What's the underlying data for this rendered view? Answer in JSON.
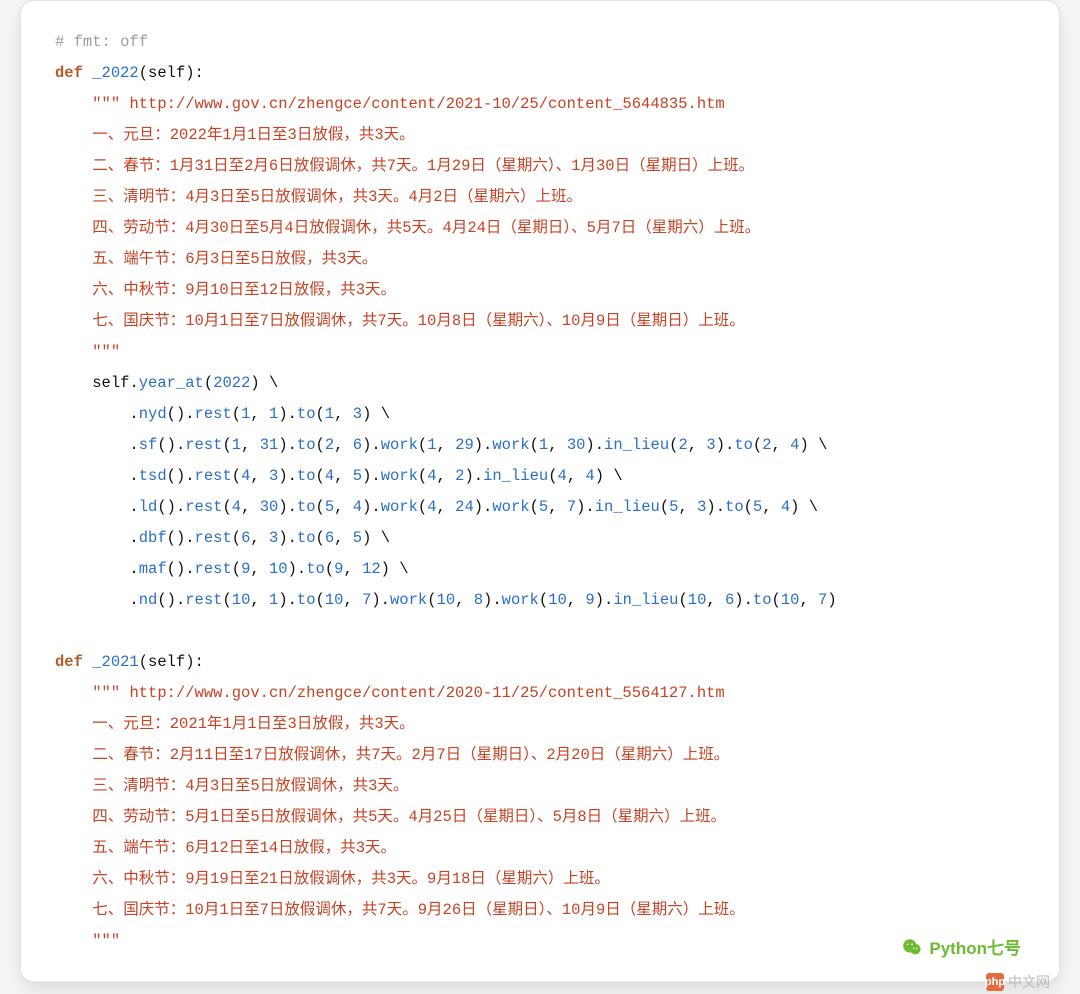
{
  "comment": "# fmt: off",
  "func1": {
    "def_kw": "def",
    "name": "_2022",
    "params": "(self):",
    "doc_open": "\"\"\"",
    "doc_url": "http://www.gov.cn/zhengce/content/2021-10/25/content_5644835.htm",
    "lines": [
      "一、元旦：2022年1月1日至3日放假，共3天。",
      "二、春节：1月31日至2月6日放假调休，共7天。1月29日（星期六）、1月30日（星期日）上班。",
      "三、清明节：4月3日至5日放假调休，共3天。4月2日（星期六）上班。",
      "四、劳动节：4月30日至5月4日放假调休，共5天。4月24日（星期日）、5月7日（星期六）上班。",
      "五、端午节：6月3日至5日放假，共3天。",
      "六、中秋节：9月10日至12日放假，共3天。",
      "七、国庆节：10月1日至7日放假调休，共7天。10月8日（星期六）、10月9日（星期日）上班。"
    ],
    "doc_close": "\"\"\"",
    "self": "self",
    "dot": ".",
    "bs": "\\",
    "m": {
      "year_at": "year_at",
      "nyd": "nyd",
      "sf": "sf",
      "tsd": "tsd",
      "ld": "ld",
      "dbf": "dbf",
      "maf": "maf",
      "nd": "nd",
      "rest": "rest",
      "to": "to",
      "work": "work",
      "in_lieu": "in_lieu"
    },
    "year_arg": "2022",
    "c_nyd": {
      "rest1": "1",
      "rest2": "1",
      "to1": "1",
      "to2": "3"
    },
    "c_sf": {
      "rest1": "1",
      "rest2": "31",
      "to1": "2",
      "to2": "6",
      "work1a": "1",
      "work1b": "29",
      "work2a": "1",
      "work2b": "30",
      "il1": "2",
      "il2": "3",
      "to3a": "2",
      "to3b": "4"
    },
    "c_tsd": {
      "rest1": "4",
      "rest2": "3",
      "to1": "4",
      "to2": "5",
      "work1a": "4",
      "work1b": "2",
      "il1": "4",
      "il2": "4"
    },
    "c_ld": {
      "rest1": "4",
      "rest2": "30",
      "to1": "5",
      "to2": "4",
      "work1a": "4",
      "work1b": "24",
      "work2a": "5",
      "work2b": "7",
      "il1": "5",
      "il2": "3",
      "to3a": "5",
      "to3b": "4"
    },
    "c_dbf": {
      "rest1": "6",
      "rest2": "3",
      "to1": "6",
      "to2": "5"
    },
    "c_maf": {
      "rest1": "9",
      "rest2": "10",
      "to1": "9",
      "to2": "12"
    },
    "c_nd": {
      "rest1": "10",
      "rest2": "1",
      "to1": "10",
      "to2": "7",
      "work1a": "10",
      "work1b": "8",
      "work2a": "10",
      "work2b": "9",
      "il1": "10",
      "il2": "6",
      "to3a": "10",
      "to3b": "7"
    }
  },
  "func2": {
    "def_kw": "def",
    "name": "_2021",
    "params": "(self):",
    "doc_open": "\"\"\"",
    "doc_url": "http://www.gov.cn/zhengce/content/2020-11/25/content_5564127.htm",
    "lines": [
      "一、元旦：2021年1月1日至3日放假，共3天。",
      "二、春节：2月11日至17日放假调休，共7天。2月7日（星期日）、2月20日（星期六）上班。",
      "三、清明节：4月3日至5日放假调休，共3天。",
      "四、劳动节：5月1日至5日放假调休，共5天。4月25日（星期日）、5月8日（星期六）上班。",
      "五、端午节：6月12日至14日放假，共3天。",
      "六、中秋节：9月19日至21日放假调休，共3天。9月18日（星期六）上班。",
      "七、国庆节：10月1日至7日放假调休，共7天。9月26日（星期日）、10月9日（星期六）上班。"
    ],
    "doc_close": "\"\"\""
  },
  "watermark": "Python七号",
  "brand": "中文网"
}
